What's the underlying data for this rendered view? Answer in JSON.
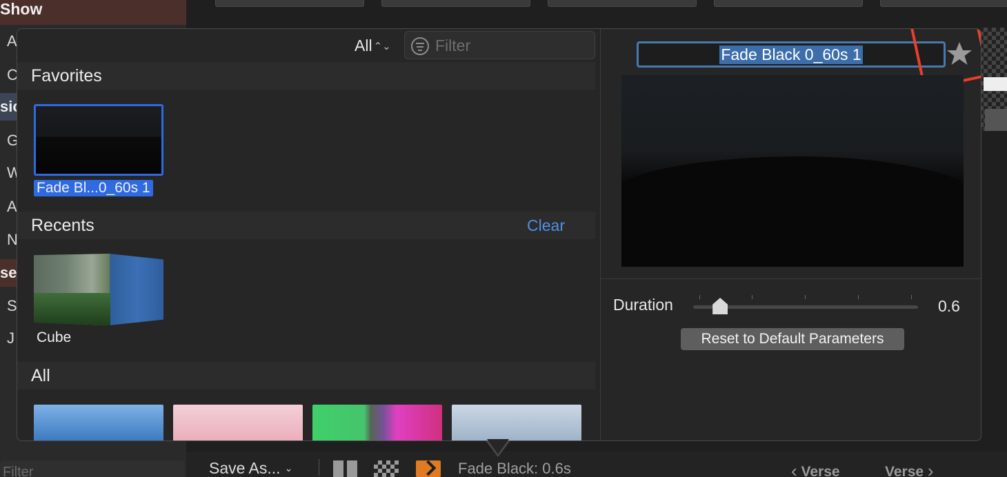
{
  "background": {
    "sidebar": {
      "header": "Show",
      "rows": [
        "A",
        "C",
        "sic",
        "G",
        "W",
        "A",
        "N",
        "se",
        "S",
        "J"
      ],
      "filter_placeholder": "Filter"
    }
  },
  "toolbar": {
    "save_as_label": "Save As...",
    "chevron": "⌄",
    "transition_label": "Fade Black: 0.6s",
    "prev_label": "Verse",
    "next_label": "Verse",
    "prev_arrow": "‹",
    "next_arrow": "›"
  },
  "popover": {
    "category_select": "All",
    "category_updown": "⌃⌄",
    "filter_placeholder": "Filter",
    "sections": {
      "favorites": {
        "title": "Favorites",
        "items": [
          {
            "label": "Fade Bl...0_60s 1",
            "selected": true
          }
        ]
      },
      "recents": {
        "title": "Recents",
        "clear_label": "Clear",
        "items": [
          {
            "label": "Cube"
          }
        ]
      },
      "all": {
        "title": "All"
      }
    },
    "inspector": {
      "name": "Fade Black 0_60s 1",
      "star_icon": "star-icon",
      "duration_label": "Duration",
      "duration_value": "0.6",
      "duration_fraction": 0.12,
      "reset_label": "Reset to Default Parameters"
    }
  },
  "colors": {
    "accent": "#2e6ae0",
    "link": "#4f8fe6",
    "annotation": "#e8402a",
    "transition_icon": "#e07b22"
  }
}
